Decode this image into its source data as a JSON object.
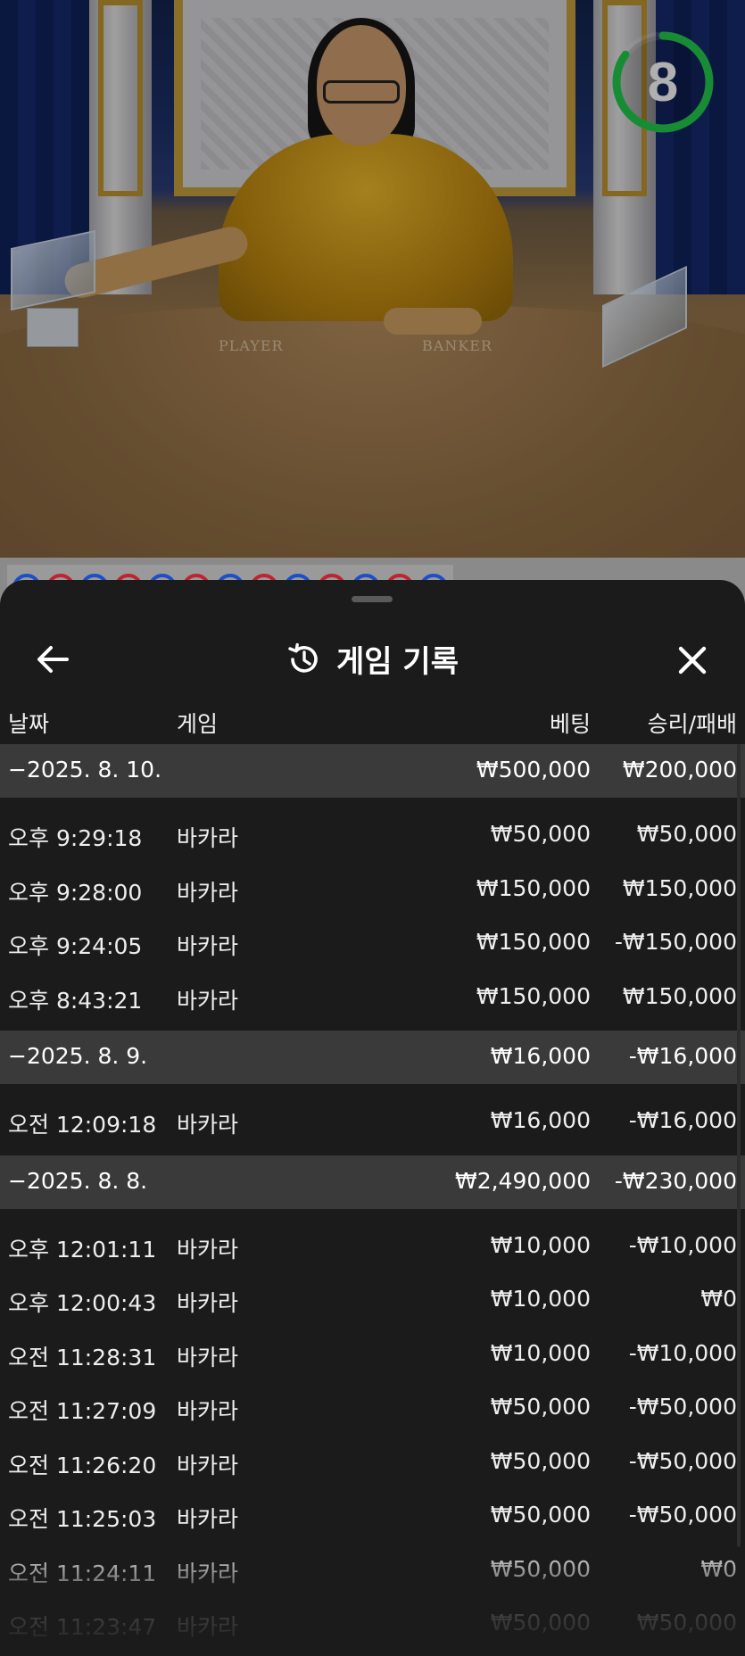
{
  "timer": {
    "value": "8",
    "progress": 0.85,
    "color": "#22c34a"
  },
  "table_labels": {
    "player": "PLAYER",
    "banker": "BANKER"
  },
  "road_beads": [
    "blue",
    "red",
    "blue",
    "red",
    "blue",
    "red",
    "blue",
    "red",
    "blue",
    "red",
    "blue",
    "red",
    "blue"
  ],
  "sheet": {
    "title": "게임 기록",
    "columns": {
      "date": "날짜",
      "game": "게임",
      "bet": "베팅",
      "result": "승리/패배"
    },
    "groups": [
      {
        "date": "−2025. 8. 10.",
        "bet": "₩500,000",
        "result": "₩200,000",
        "rows": [
          {
            "time": "오후 9:29:18",
            "game": "바카라",
            "bet": "₩50,000",
            "result": "₩50,000"
          },
          {
            "time": "오후 9:28:00",
            "game": "바카라",
            "bet": "₩150,000",
            "result": "₩150,000"
          },
          {
            "time": "오후 9:24:05",
            "game": "바카라",
            "bet": "₩150,000",
            "result": "-₩150,000"
          },
          {
            "time": "오후 8:43:21",
            "game": "바카라",
            "bet": "₩150,000",
            "result": "₩150,000"
          }
        ]
      },
      {
        "date": "−2025. 8. 9.",
        "bet": "₩16,000",
        "result": "-₩16,000",
        "rows": [
          {
            "time": "오전 12:09:18",
            "game": "바카라",
            "bet": "₩16,000",
            "result": "-₩16,000"
          }
        ]
      },
      {
        "date": "−2025. 8. 8.",
        "bet": "₩2,490,000",
        "result": "-₩230,000",
        "rows": [
          {
            "time": "오후 12:01:11",
            "game": "바카라",
            "bet": "₩10,000",
            "result": "-₩10,000"
          },
          {
            "time": "오후 12:00:43",
            "game": "바카라",
            "bet": "₩10,000",
            "result": "₩0"
          },
          {
            "time": "오전 11:28:31",
            "game": "바카라",
            "bet": "₩10,000",
            "result": "-₩10,000"
          },
          {
            "time": "오전 11:27:09",
            "game": "바카라",
            "bet": "₩50,000",
            "result": "-₩50,000"
          },
          {
            "time": "오전 11:26:20",
            "game": "바카라",
            "bet": "₩50,000",
            "result": "-₩50,000"
          },
          {
            "time": "오전 11:25:03",
            "game": "바카라",
            "bet": "₩50,000",
            "result": "-₩50,000"
          },
          {
            "time": "오전 11:24:11",
            "game": "바카라",
            "bet": "₩50,000",
            "result": "₩0"
          },
          {
            "time": "오전 11:23:47",
            "game": "바카라",
            "bet": "₩50,000",
            "result": "₩50,000"
          }
        ]
      }
    ]
  }
}
